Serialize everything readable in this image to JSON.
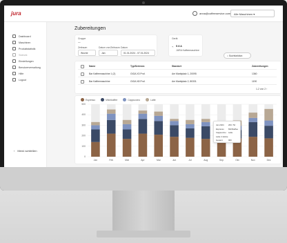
{
  "app": {
    "logo": "jura"
  },
  "header": {
    "email": "anna@coffeeservice.com",
    "account_select": "Alle Maschinen ▾"
  },
  "sidebar": {
    "items": [
      {
        "label": "Dashboard",
        "icon": "grid-icon"
      },
      {
        "label": "Maschinen",
        "icon": "machine-icon"
      },
      {
        "label": "Produktstatistik",
        "icon": "chart-icon"
      },
      {
        "label": "Statistik",
        "icon": "stats-icon"
      },
      {
        "label": "Einstellungen",
        "icon": "gear-icon"
      },
      {
        "label": "Benutzerverwaltung",
        "icon": "users-icon"
      },
      {
        "label": "Hilfe",
        "icon": "help-icon"
      },
      {
        "label": "Logout",
        "icon": "logout-icon"
      }
    ],
    "collapse_label": "Menü schließen"
  },
  "page": {
    "title": "Zubereitungen"
  },
  "filters": {
    "group_label": "Gruppe",
    "group_value": "—",
    "period_label": "Zeitraum",
    "period_value": "Woche",
    "from_label": "Datum von/Zeitraum",
    "from_value": "Jan",
    "date_label": "Datum",
    "date_value": "01.01.2024 - 07.01.2024"
  },
  "info": {
    "label": "Gerät",
    "id": "S 8 A",
    "name": "JURA Kaffeemaschine"
  },
  "search_button": "Suchfunktion",
  "table": {
    "headers": [
      "Name",
      "Typ/Seriennr.",
      "Standort",
      "Zubereitungen"
    ],
    "rows": [
      [
        "Bar Kaffeemaschine 1 (2)",
        "GIGA X3 Prof.",
        "Am Marktplatz 1, 20095",
        "1360"
      ],
      [
        "Bar Kaffeemaschine",
        "GIGA X8 Prof.",
        "Am Marktplatz 2, 80331",
        "1190"
      ]
    ],
    "pager": "1-2 von 2"
  },
  "chart_data": {
    "type": "bar",
    "legend": [
      {
        "name": "Espresso",
        "color": "#8c6446"
      },
      {
        "name": "Milchkaffee",
        "color": "#3b4a66"
      },
      {
        "name": "Cappuccino",
        "color": "#7f93c0"
      },
      {
        "name": "Latte",
        "color": "#b8a894"
      }
    ],
    "categories": [
      "Jan",
      "Feb",
      "Mär",
      "Apr",
      "Mai",
      "Jun",
      "Jul",
      "Aug",
      "Sep",
      "Okt",
      "Nov",
      "Dez"
    ],
    "ylim": [
      0,
      500
    ],
    "yticks": [
      0,
      100,
      200,
      300,
      400,
      500
    ],
    "series": [
      {
        "name": "Espresso",
        "values": [
          140,
          220,
          170,
          220,
          210,
          190,
          180,
          170,
          160,
          175,
          190,
          175
        ]
      },
      {
        "name": "Milchkaffee",
        "values": [
          120,
          130,
          90,
          140,
          130,
          110,
          90,
          120,
          110,
          80,
          140,
          120
        ]
      },
      {
        "name": "Cappuccino",
        "values": [
          40,
          60,
          50,
          50,
          50,
          40,
          40,
          40,
          30,
          40,
          40,
          50
        ]
      },
      {
        "name": "Latte",
        "values": [
          30,
          40,
          40,
          30,
          40,
          20,
          40,
          30,
          40,
          50,
          50,
          110
        ]
      }
    ],
    "tooltip": {
      "rows": [
        {
          "k": "Jan 2024",
          "v": "200 / 52"
        },
        {
          "k": "Espresso",
          "v": "Milchkaffee"
        },
        {
          "k": "Cappuccino",
          "v": "Latte"
        },
        {
          "k": "Latte 2 stücke",
          "v": ""
        },
        {
          "k": "Gesamt",
          "v": "900"
        }
      ]
    }
  }
}
